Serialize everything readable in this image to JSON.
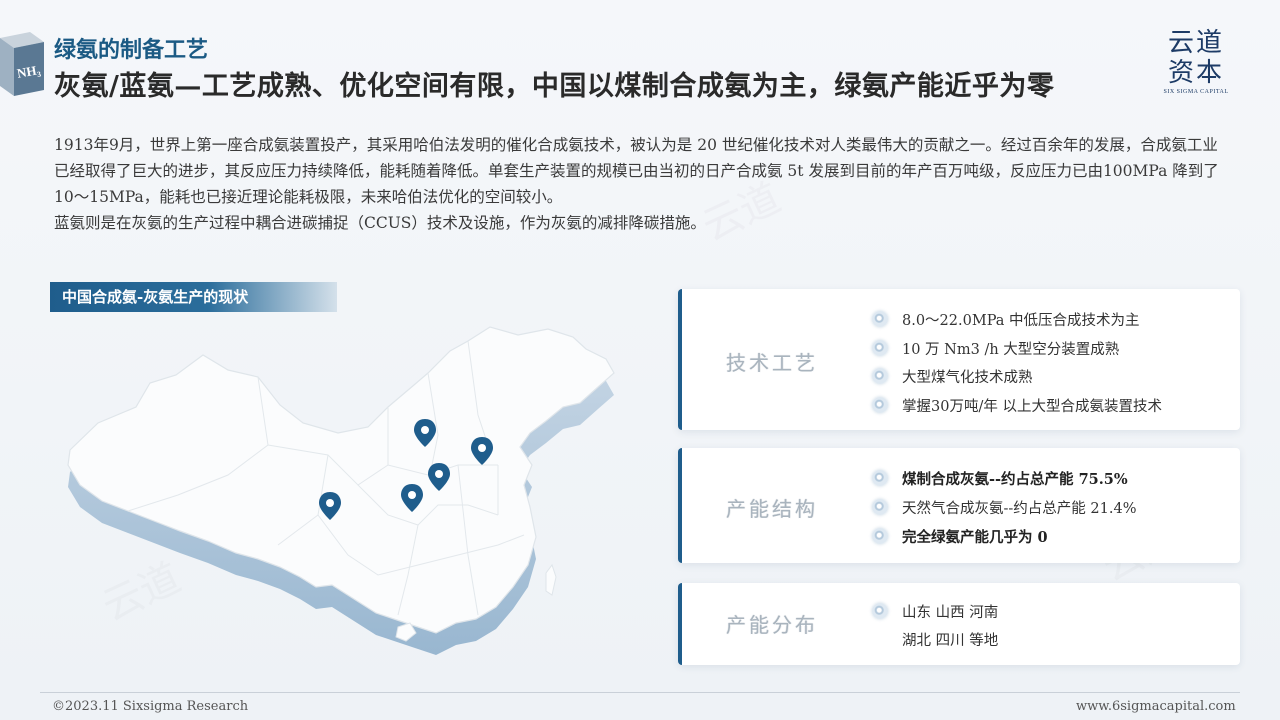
{
  "header": {
    "badge_text": "NH₃",
    "subtitle": "绿氨的制备工艺",
    "title": "灰氨/蓝氨—工艺成熟、优化空间有限，中国以煤制合成氨为主，绿氨产能近乎为零"
  },
  "logo": {
    "line1": "云道",
    "line2": "资本",
    "line3": "SIX SIGMA CAPITAL"
  },
  "intro": {
    "p1": "1913年9月，世界上第一座合成氨装置投产，其采用哈伯法发明的催化合成氨技术，被认为是 20 世纪催化技术对人类最伟大的贡献之一。经过百余年的发展，合成氨工业已经取得了巨大的进步，其反应压力持续降低，能耗随着降低。单套生产装置的规模已由当初的日产合成氨 5t 发展到目前的年产百万吨级，反应压力已由100MPa 降到了10～15MPa，能耗也已接近理论能耗极限，未来哈伯法优化的空间较小。",
    "p2": "蓝氨则是在灰氨的生产过程中耦合进碳捕捉（CCUS）技术及设施，作为灰氨的减排降碳措施。"
  },
  "section": {
    "tag": "中国合成氨-灰氨生产的现状"
  },
  "cards": [
    {
      "label": "技术工艺",
      "items": [
        {
          "text": "8.0～22.0MPa 中低压合成技术为主",
          "bold": false
        },
        {
          "text": "10 万 Nm3 /h 大型空分装置成熟",
          "bold": false
        },
        {
          "text": "大型煤气化技术成熟",
          "bold": false
        },
        {
          "text": "掌握30万吨/年 以上大型合成氨装置技术",
          "bold": false
        }
      ]
    },
    {
      "label": "产能结构",
      "items": [
        {
          "text": "煤制合成灰氨--约占总产能 75.5%",
          "bold": true
        },
        {
          "text": "天然气合成灰氨--约占总产能 21.4%",
          "bold": false
        },
        {
          "text": "完全绿氨产能几乎为 0",
          "bold": true
        }
      ]
    },
    {
      "label": "产能分布",
      "items": [
        {
          "text": "山东 山西 河南",
          "bold": false
        },
        {
          "text": "湖北 四川 等地",
          "bold": false
        }
      ]
    }
  ],
  "footer": {
    "left": "©2023.11 Sixsigma Research",
    "right": "www.6sigmacapital.com"
  },
  "colors": {
    "accent": "#1f5d8c",
    "title": "#1b5a84",
    "pin": "#1f5d8c"
  }
}
